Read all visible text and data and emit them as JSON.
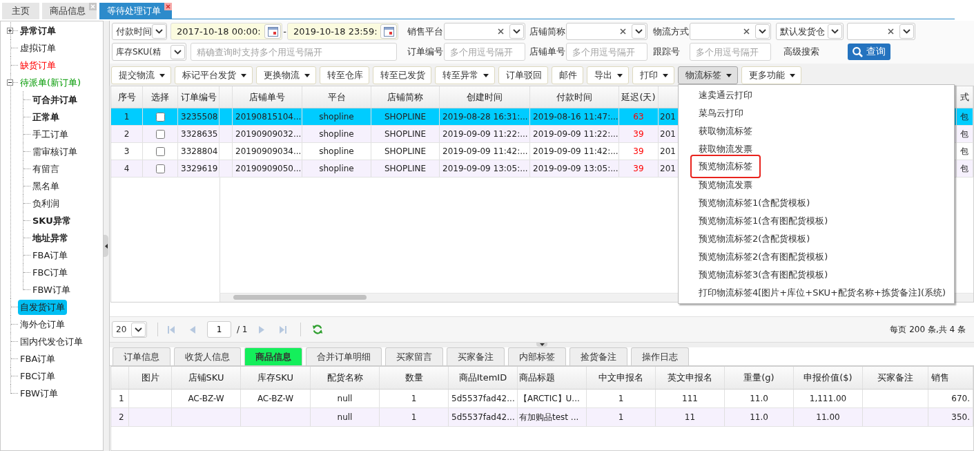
{
  "tabs": [
    {
      "label": "主页",
      "selected": false,
      "closable": false
    },
    {
      "label": "商品信息",
      "selected": false,
      "closable": true
    },
    {
      "label": "等待处理订单",
      "selected": true,
      "closable": true
    }
  ],
  "sidebar": {
    "items": [
      {
        "label": "异常订单",
        "kind": "folder",
        "expanded": false,
        "bold": true,
        "selected": false
      },
      {
        "label": "虚拟订单",
        "kind": "leaf",
        "bold": false,
        "selected": false
      },
      {
        "label": "缺货订单",
        "kind": "leaf",
        "bold": false,
        "color": "#ff0000",
        "selected": false
      },
      {
        "label": "待派单(新订单)",
        "kind": "folder",
        "expanded": true,
        "bold": false,
        "color": "#009900",
        "selected": false,
        "children": [
          {
            "label": "可合并订单",
            "kind": "leaf",
            "bold": true,
            "selected": false
          },
          {
            "label": "正常单",
            "kind": "leaf",
            "bold": true,
            "selected": false
          },
          {
            "label": "手工订单",
            "kind": "leaf",
            "bold": false,
            "selected": false
          },
          {
            "label": "需审核订单",
            "kind": "leaf",
            "bold": false,
            "selected": false
          },
          {
            "label": "有留言",
            "kind": "leaf",
            "bold": false,
            "selected": false
          },
          {
            "label": "黑名单",
            "kind": "leaf",
            "bold": false,
            "selected": false
          },
          {
            "label": "负利润",
            "kind": "leaf",
            "bold": false,
            "selected": false
          },
          {
            "label": "SKU异常",
            "kind": "leaf",
            "bold": true,
            "selected": false
          },
          {
            "label": "地址异常",
            "kind": "leaf",
            "bold": true,
            "selected": false
          },
          {
            "label": "FBA订单",
            "kind": "leaf",
            "bold": false,
            "selected": false
          },
          {
            "label": "FBC订单",
            "kind": "leaf",
            "bold": false,
            "selected": false
          },
          {
            "label": "FBW订单",
            "kind": "leaf",
            "bold": false,
            "selected": false
          }
        ]
      },
      {
        "label": "自发货订单",
        "kind": "leaf",
        "bold": false,
        "selected": true
      },
      {
        "label": "海外仓订单",
        "kind": "leaf",
        "bold": false,
        "selected": false
      },
      {
        "label": "国内代发仓订单",
        "kind": "leaf",
        "bold": false,
        "selected": false
      },
      {
        "label": "FBA订单",
        "kind": "leaf",
        "bold": false,
        "selected": false
      },
      {
        "label": "FBC订单",
        "kind": "leaf",
        "bold": false,
        "selected": false
      },
      {
        "label": "FBW订单",
        "kind": "leaf",
        "bold": false,
        "selected": false
      }
    ]
  },
  "filters": {
    "date_type": "付款时间",
    "date_from": "2017-10-18 00:00:",
    "date_separator": "-",
    "date_to": "2019-10-18 23:59:",
    "platform_label": "销售平台",
    "store_label": "店铺简称",
    "shipping_label": "物流方式",
    "warehouse": "默认发货仓",
    "sku_mode": "库存SKU(精",
    "sku_query": {
      "placeholder": "精确查询时支持多个用逗号隔开"
    },
    "order_no": {
      "label": "订单编号",
      "placeholder": "多个用逗号隔开"
    },
    "store_order_no": {
      "label": "店铺单号",
      "placeholder": "多个用逗号隔开"
    },
    "tracking_no": {
      "label": "跟踪号",
      "placeholder": "多个用逗号隔开"
    },
    "advanced_search": "高级搜索",
    "search_button": "查询"
  },
  "toolbar": [
    {
      "label": "提交物流",
      "dropdown": true,
      "open": false
    },
    {
      "label": "标记平台发货",
      "dropdown": true,
      "open": false
    },
    {
      "label": "更换物流",
      "dropdown": true,
      "open": false
    },
    {
      "label": "转至仓库",
      "dropdown": false,
      "open": false
    },
    {
      "label": "转至已发货",
      "dropdown": false,
      "open": false
    },
    {
      "label": "转至异常",
      "dropdown": true,
      "open": false
    },
    {
      "label": "订单驳回",
      "dropdown": false,
      "open": false
    },
    {
      "label": "邮件",
      "dropdown": false,
      "open": false
    },
    {
      "label": "导出",
      "dropdown": true,
      "open": false
    },
    {
      "label": "打印",
      "dropdown": true,
      "open": false
    },
    {
      "label": "物流标签",
      "dropdown": true,
      "open": true,
      "menu": [
        {
          "label": "速卖通云打印",
          "highlighted": false
        },
        {
          "label": "菜鸟云打印",
          "highlighted": false
        },
        {
          "label": "获取物流标签",
          "highlighted": false
        },
        {
          "label": "获取物流发票",
          "highlighted": false
        },
        {
          "label": "预览物流标签",
          "highlighted": true
        },
        {
          "label": "预览物流发票",
          "highlighted": false
        },
        {
          "label": "预览物流标签1(含配货模板)",
          "highlighted": false
        },
        {
          "label": "预览物流标签1(含有图配货模板)",
          "highlighted": false
        },
        {
          "label": "预览物流标签2(含配货模板)",
          "highlighted": false
        },
        {
          "label": "预览物流标签2(含有图配货模板)",
          "highlighted": false
        },
        {
          "label": "预览物流标签3(含有图配货模板)",
          "highlighted": false
        },
        {
          "label": "打印物流标签4[图片+库位+SKU+配货名称+拣货备注](系统)",
          "highlighted": false
        }
      ]
    },
    {
      "label": "更多功能",
      "dropdown": true,
      "open": false
    }
  ],
  "orders_table": {
    "headers": {
      "row_no": "序号",
      "select": "选择",
      "order_no": "订单编号",
      "store_order_no": "店铺单号",
      "platform": "平台",
      "store": "店铺简称",
      "created": "创建时间",
      "paid": "付款时间",
      "delay": "延迟(天)",
      "column_12": "式"
    },
    "rows": [
      {
        "selected": true,
        "row_no": "1",
        "checked": false,
        "order_no": "3235508",
        "store_order_no": "20190815104...",
        "platform": "shopline",
        "store": "SHOPLINE",
        "created": "2019-08-28 16:31:...",
        "paid": "2019-08-16 11:47:...",
        "delay": "63",
        "column_11": "201",
        "column_12": "包"
      },
      {
        "selected": false,
        "row_no": "2",
        "checked": false,
        "order_no": "3328635",
        "store_order_no": "20190909032...",
        "platform": "shopline",
        "store": "SHOPLINE",
        "created": "2019-09-09 11:22:...",
        "paid": "2019-09-09 11:22:...",
        "delay": "39",
        "column_11": "201",
        "column_12": "包"
      },
      {
        "selected": false,
        "row_no": "3",
        "checked": false,
        "order_no": "3328804",
        "store_order_no": "20190909034...",
        "platform": "shopline",
        "store": "SHOPLINE",
        "created": "2019-09-09 11:42:...",
        "paid": "2019-09-09 11:42:...",
        "delay": "39",
        "column_11": "201",
        "column_12": "包"
      },
      {
        "selected": false,
        "row_no": "4",
        "checked": false,
        "order_no": "3329619",
        "store_order_no": "20190909050...",
        "platform": "shopline",
        "store": "SHOPLINE",
        "created": "2019-09-09 13:05:...",
        "paid": "2019-09-09 13:05:...",
        "delay": "39",
        "column_11": "201",
        "column_12": "包"
      }
    ]
  },
  "pager": {
    "page_size": "20",
    "page": "1",
    "page_count": "/ 1",
    "summary": "每页 200 条,共 4 条"
  },
  "detail_tabs": [
    {
      "label": "订单信息",
      "selected": false
    },
    {
      "label": "收货人信息",
      "selected": false
    },
    {
      "label": "商品信息",
      "selected": true
    },
    {
      "label": "合并订单明细",
      "selected": false
    },
    {
      "label": "买家留言",
      "selected": false
    },
    {
      "label": "买家备注",
      "selected": false
    },
    {
      "label": "内部标签",
      "selected": false
    },
    {
      "label": "捡货备注",
      "selected": false
    },
    {
      "label": "操作日志",
      "selected": false
    }
  ],
  "goods_table": {
    "headers": {
      "image": "图片",
      "store_sku": "店铺SKU",
      "stock_sku": "库存SKU",
      "pick_name": "配货名称",
      "quantity": "数量",
      "item_id": "商品ItemID",
      "title": "商品标题",
      "cn_declared": "中文申报名",
      "en_declared": "英文申报名",
      "weight": "重量(g)",
      "declared_value": "申报价值($)",
      "buyer_note": "买家备注",
      "column_14": "销售"
    },
    "rows": [
      {
        "row_no": "1",
        "store_sku": "AC-BZ-W",
        "stock_sku": "AC-BZ-W",
        "pick_name": "null",
        "quantity": "1",
        "item_id": "5d5537fad42...",
        "title": "【ARCTIC】U...",
        "cn_declared": "1",
        "en_declared": "111",
        "weight": "11.0",
        "declared_value": "1,111.00",
        "column_14": "670."
      },
      {
        "row_no": "2",
        "pick_name": "null",
        "quantity": "1",
        "item_id": "5d5537fad42...",
        "title": "有加购品test ...",
        "cn_declared": "1",
        "en_declared": "11",
        "weight": "11.0",
        "declared_value": "11.00",
        "column_14": "350."
      }
    ]
  }
}
